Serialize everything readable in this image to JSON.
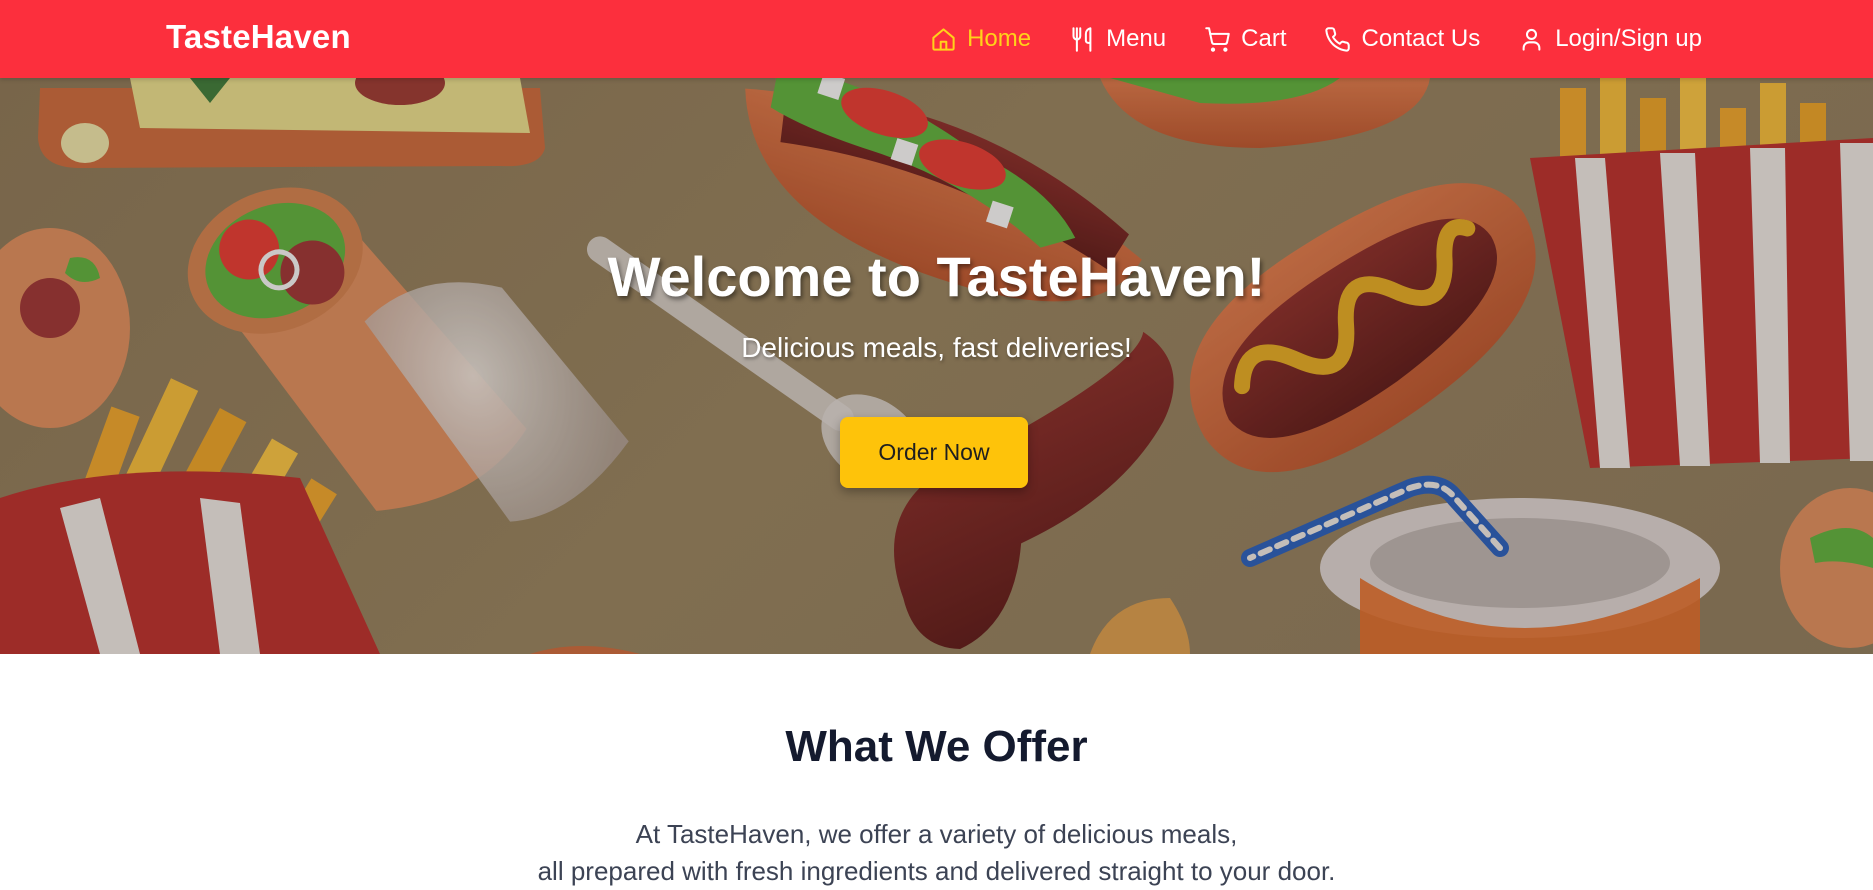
{
  "brand": "TasteHaven",
  "nav": {
    "home": "Home",
    "menu": "Menu",
    "cart": "Cart",
    "contact": "Contact Us",
    "login": "Login/Sign up"
  },
  "hero": {
    "title": "Welcome to TasteHaven!",
    "subtitle": "Delicious meals, fast deliveries!",
    "cta": "Order Now"
  },
  "offer": {
    "title": "What We Offer",
    "line1": "At TasteHaven, we offer a variety of delicious meals,",
    "line2": "all prepared with fresh ingredients and delivered straight to your door."
  },
  "colors": {
    "navbar": "#fc2f3d",
    "active_nav": "#ffd21a",
    "cta": "#fec30a",
    "heading": "#141a2e"
  },
  "icons": {
    "home": "home-icon",
    "menu": "utensils-icon",
    "cart": "cart-icon",
    "contact": "phone-icon",
    "login": "user-icon"
  }
}
